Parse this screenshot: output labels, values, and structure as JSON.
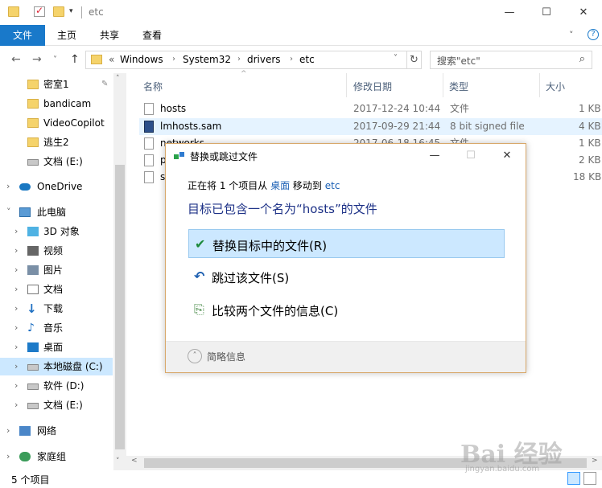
{
  "window": {
    "title": "etc",
    "minimize": "—",
    "maximize": "☐",
    "close": "✕",
    "quickaccess_drop": "▾"
  },
  "ribbon": {
    "tabs": [
      "文件",
      "主页",
      "共享",
      "查看"
    ],
    "collapse": "˅",
    "help": "?"
  },
  "nav": {
    "back": "←",
    "forward": "→",
    "recent": "˅",
    "up": "↑",
    "overflow": "«",
    "crumbs": [
      "Windows",
      "System32",
      "drivers",
      "etc"
    ],
    "crumb_sep": "›",
    "addr_drop": "˅",
    "refresh": "↻",
    "search_placeholder": "搜索\"etc\"",
    "search_icon": "⌕"
  },
  "sidebar": {
    "items": [
      {
        "label": "密室1",
        "icon": "folder-icon",
        "pinned": true
      },
      {
        "label": "bandicam",
        "icon": "folder-icon"
      },
      {
        "label": "VideoCopilot",
        "icon": "folder-icon"
      },
      {
        "label": "逃生2",
        "icon": "folder-icon"
      },
      {
        "label": "文档 (E:)",
        "icon": "drive-icon"
      },
      {
        "label": "OneDrive",
        "icon": "cloud-icon",
        "chevron": "›"
      },
      {
        "label": "此电脑",
        "icon": "computer-icon",
        "chevron": "˅"
      },
      {
        "label": "3D 对象",
        "icon": "cube-icon",
        "chevron": "›"
      },
      {
        "label": "视频",
        "icon": "video-icon",
        "chevron": "›"
      },
      {
        "label": "图片",
        "icon": "picture-icon",
        "chevron": "›"
      },
      {
        "label": "文档",
        "icon": "document-icon",
        "chevron": "›"
      },
      {
        "label": "下载",
        "icon": "download-icon",
        "chevron": "›"
      },
      {
        "label": "音乐",
        "icon": "music-icon",
        "chevron": "›"
      },
      {
        "label": "桌面",
        "icon": "desktop-icon",
        "chevron": "›"
      },
      {
        "label": "本地磁盘 (C:)",
        "icon": "drive-icon",
        "chevron": "›",
        "selected": true
      },
      {
        "label": "软件 (D:)",
        "icon": "drive-icon",
        "chevron": "›"
      },
      {
        "label": "文档 (E:)",
        "icon": "drive-icon",
        "chevron": "›"
      },
      {
        "label": "网络",
        "icon": "network-icon",
        "chevron": "›"
      },
      {
        "label": "家庭组",
        "icon": "homegroup-icon",
        "chevron": "›"
      }
    ],
    "pin_icon": "📌",
    "scroll_up": "˄",
    "scroll_down": "˅"
  },
  "files": {
    "columns": [
      "名称",
      "修改日期",
      "类型",
      "大小"
    ],
    "sort_indicator": "^",
    "rows": [
      {
        "name": "hosts",
        "date": "2017-12-24 10:44",
        "type": "文件",
        "size": "1 KB"
      },
      {
        "name": "lmhosts.sam",
        "date": "2017-09-29 21:44",
        "type": "8 bit signed file",
        "size": "4 KB",
        "highlight": true
      },
      {
        "name": "networks",
        "date": "2017-06-18 16:45",
        "type": "文件",
        "size": "1 KB"
      },
      {
        "name": "p",
        "date": "",
        "type": "",
        "size": "2 KB"
      },
      {
        "name": "s",
        "date": "",
        "type": "",
        "size": "18 KB"
      }
    ],
    "hscroll_left": "<",
    "hscroll_right": ">"
  },
  "status": {
    "text": "5 个项目"
  },
  "dialog": {
    "title": "替换或跳过文件",
    "minimize": "—",
    "maximize": "☐",
    "close": "✕",
    "sub_prefix": "正在将 1 个项目从 ",
    "sub_from": "桌面",
    "sub_mid": " 移动到 ",
    "sub_to": "etc",
    "heading": "目标已包含一个名为“hosts”的文件",
    "options": [
      {
        "label": "替换目标中的文件(R)",
        "icon": "✔",
        "selected": true
      },
      {
        "label": "跳过该文件(S)",
        "icon": "↶"
      },
      {
        "label": "比较两个文件的信息(C)",
        "icon": "⎘"
      }
    ],
    "more_icon": "˄",
    "more_label": "简略信息"
  },
  "watermark": {
    "text": "Bai 经验",
    "sub": "jingyan.baidu.com"
  },
  "colors": {
    "accent": "#1979ca",
    "selection": "#cce8ff",
    "heading": "#1e3287",
    "link": "#1a5fb4"
  }
}
